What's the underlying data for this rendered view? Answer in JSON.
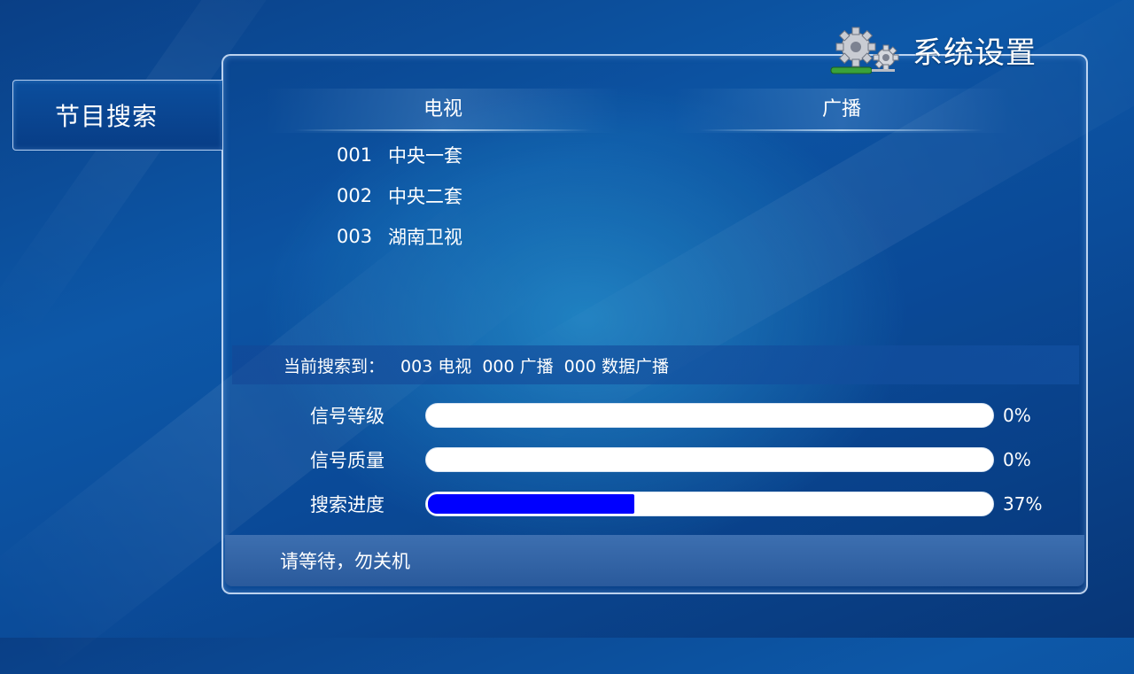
{
  "header": {
    "title": "系统设置",
    "icon": "gears-screwdriver-icon"
  },
  "side_tab": {
    "label": "节目搜索"
  },
  "columns": {
    "tv": "电视",
    "radio": "广播"
  },
  "channels": [
    {
      "num": "001",
      "name": "中央一套"
    },
    {
      "num": "002",
      "name": "中央二套"
    },
    {
      "num": "003",
      "name": "湖南卫视"
    }
  ],
  "found": {
    "label": "当前搜索到：",
    "tv": "003 电视",
    "radio": "000 广播",
    "data": "000 数据广播"
  },
  "meters": [
    {
      "label": "信号等级",
      "value_text": "0%",
      "value": 0
    },
    {
      "label": "信号质量",
      "value_text": "0%",
      "value": 0
    },
    {
      "label": "搜索进度",
      "value_text": "37%",
      "value": 37
    }
  ],
  "status": {
    "message": "请等待，勿关机"
  },
  "colors": {
    "progress_fill": "#0000ff",
    "track": "#ffffff",
    "background": "#0b4c9a"
  }
}
